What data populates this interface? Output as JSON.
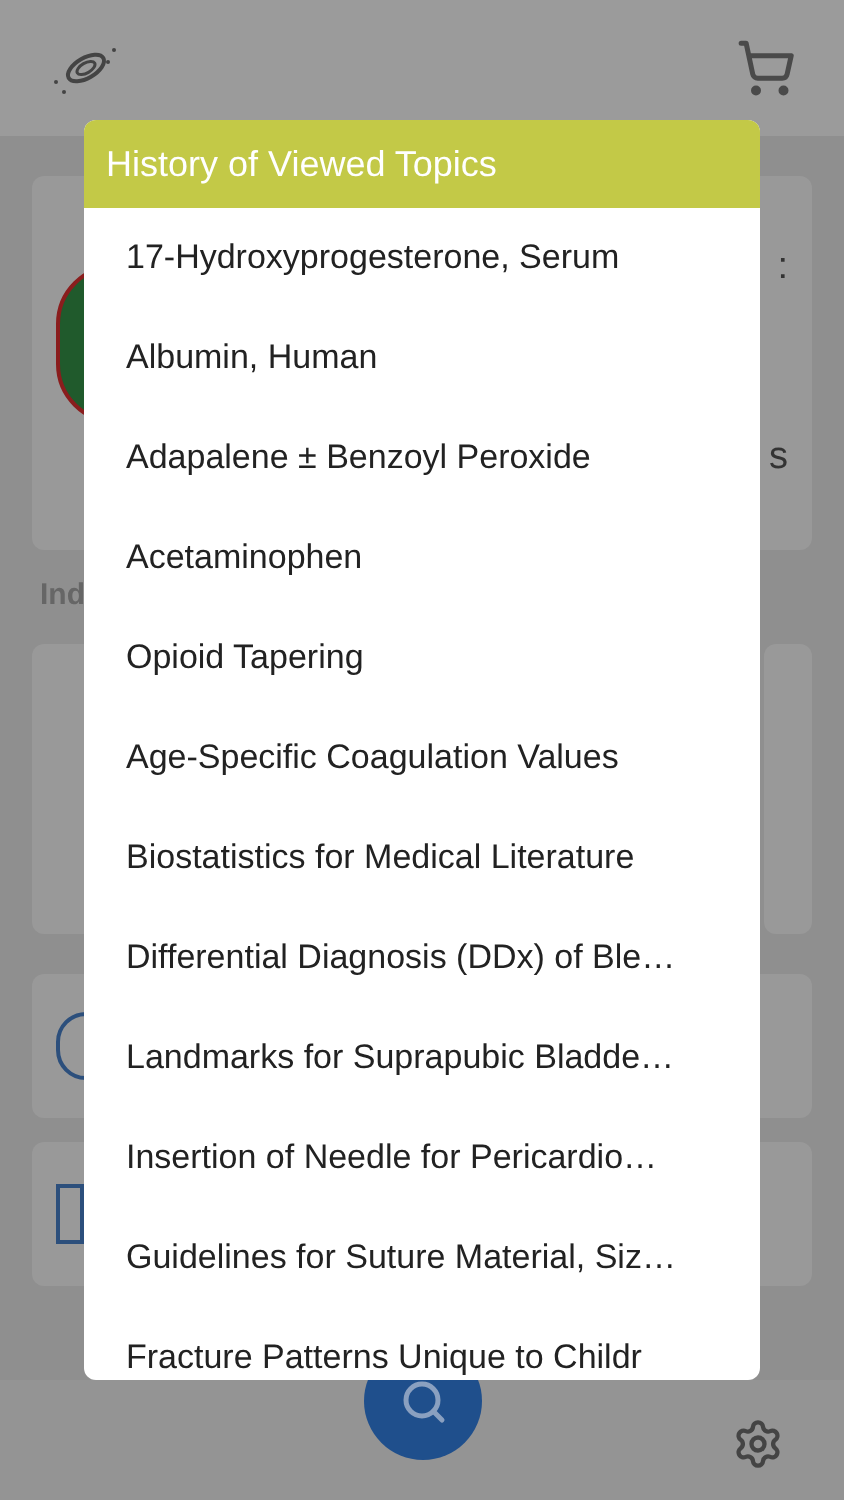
{
  "background": {
    "card_fragments": [
      ":",
      "s"
    ],
    "section_label": "Ind"
  },
  "popup": {
    "title": "History of Viewed Topics",
    "items": [
      "17-Hydroxyprogesterone, Serum",
      "Albumin, Human",
      "Adapalene ± Benzoyl Peroxide",
      "Acetaminophen",
      "Opioid Tapering",
      "Age-Specific Coagulation Values",
      "Biostatistics for Medical Literature",
      "Differential Diagnosis (DDx) of Ble…",
      "Landmarks for Suprapubic Bladde…",
      "Insertion of Needle for Pericardio…",
      "Guidelines for Suture Material, Siz…",
      "Fracture Patterns Unique to Childr"
    ]
  }
}
